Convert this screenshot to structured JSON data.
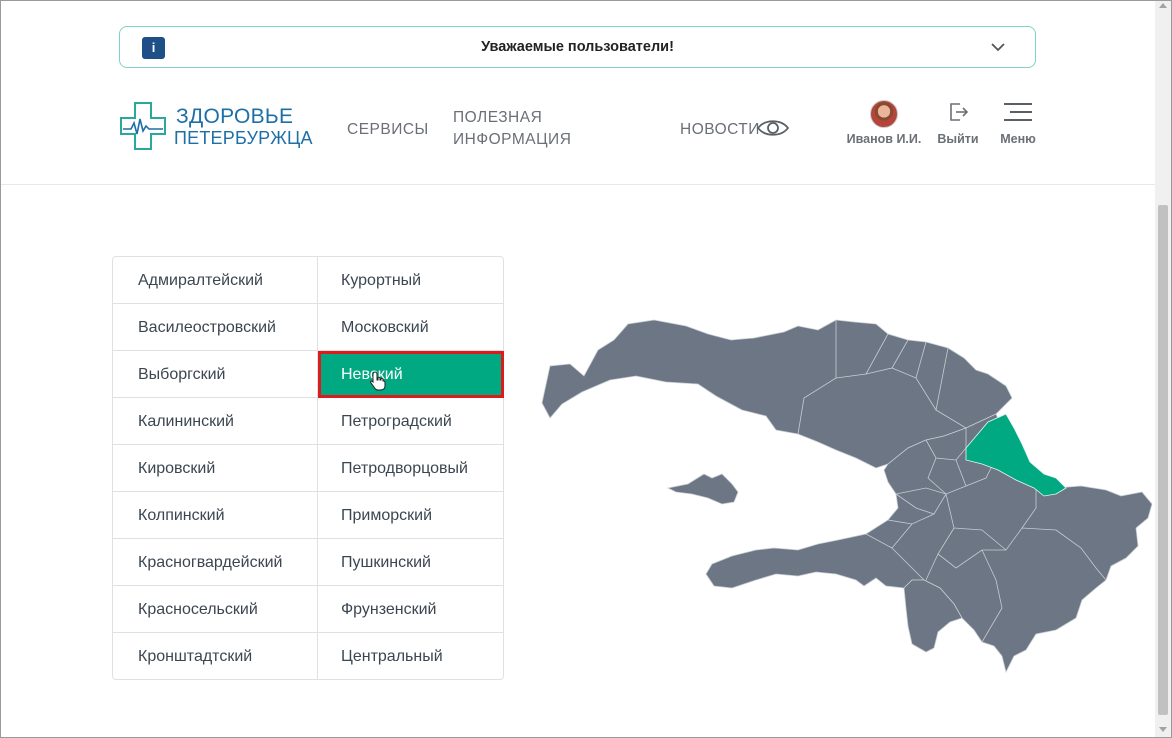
{
  "notice": {
    "title": "Уважаемые пользователи!",
    "icon": "i"
  },
  "logo": {
    "line1": "ЗДОРОВЬЕ",
    "line2": "ПЕТЕРБУРЖЦА"
  },
  "nav": {
    "services": "СЕРВИСЫ",
    "useful_line1": "ПОЛЕЗНАЯ",
    "useful_line2": "ИНФОРМАЦИЯ",
    "news": "НОВОСТИ"
  },
  "user": {
    "name": "Иванов И.И.",
    "logout": "Выйти",
    "menu": "Меню"
  },
  "districts": {
    "left": [
      "Адмиралтейский",
      "Василеостровский",
      "Выборгский",
      "Калининский",
      "Кировский",
      "Колпинский",
      "Красногвардейский",
      "Красносельский",
      "Кронштадтский"
    ],
    "right": [
      "Курортный",
      "Московский",
      "Невский",
      "Петроградский",
      "Петродворцовый",
      "Приморский",
      "Пушкинский",
      "Фрунзенский",
      "Центральный"
    ],
    "selected": "Невский"
  },
  "colors": {
    "accent": "#00a982",
    "map_fill": "#6c7684",
    "highlight_border": "#e0191a",
    "brand": "#1d6fa8"
  }
}
